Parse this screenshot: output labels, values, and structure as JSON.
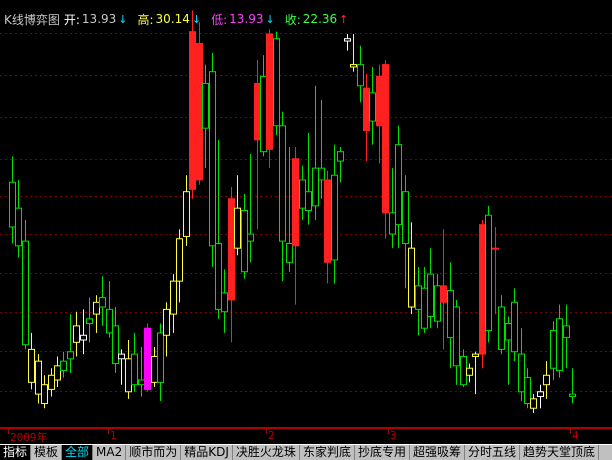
{
  "header": {
    "title": "K线博弈图",
    "open_label": "开:",
    "open_value": "13.93",
    "open_arrow": "↓",
    "high_label": "高:",
    "high_value": "30.14",
    "high_arrow": "↓",
    "low_label": "低:",
    "low_value": "13.93",
    "low_arrow": "↓",
    "close_label": "收:",
    "close_value": "22.36",
    "close_arrow": "↑"
  },
  "timeaxis": {
    "labels": [
      "2009年",
      "1",
      "2",
      "3",
      "4"
    ]
  },
  "tabs": [
    "指标",
    "模板",
    "全部",
    "MA2",
    "顺市而为",
    "精品KDJ",
    "决胜火龙珠",
    "东家判底",
    "抄底专用",
    "超强吸筹",
    "分时五线",
    "趋势天堂顶底"
  ],
  "colors": {
    "up": "#ff2020",
    "down": "#00e000",
    "yellow": "#ffff40",
    "magenta": "#ff00ff",
    "white": "#ffffff",
    "grid": "#800000"
  },
  "chart_data": {
    "type": "candlestick",
    "ohlc_summary": {
      "open": 13.93,
      "high": 30.14,
      "low": 13.93,
      "close": 22.36
    },
    "candles": [
      {
        "o": 24.0,
        "h": 25.1,
        "l": 21.4,
        "c": 22.1,
        "color": "green"
      },
      {
        "o": 22.9,
        "h": 24.1,
        "l": 20.8,
        "c": 21.3,
        "color": "green"
      },
      {
        "o": 21.5,
        "h": 22.4,
        "l": 16.9,
        "c": 17.1,
        "color": "green"
      },
      {
        "o": 16.9,
        "h": 17.6,
        "l": 15.2,
        "c": 15.5,
        "color": "yellow"
      },
      {
        "o": 16.4,
        "h": 16.7,
        "l": 14.6,
        "c": 15.0,
        "color": "yellow"
      },
      {
        "o": 15.4,
        "h": 15.8,
        "l": 14.4,
        "c": 14.6,
        "color": "yellow"
      },
      {
        "o": 15.8,
        "h": 16.1,
        "l": 14.9,
        "c": 15.2,
        "color": "yellow"
      },
      {
        "o": 16.2,
        "h": 16.6,
        "l": 15.3,
        "c": 15.6,
        "color": "yellow"
      },
      {
        "o": 16.0,
        "h": 16.8,
        "l": 15.7,
        "c": 16.4,
        "color": "green"
      },
      {
        "o": 16.5,
        "h": 18.4,
        "l": 15.9,
        "c": 16.8,
        "color": "green"
      },
      {
        "o": 17.2,
        "h": 18.5,
        "l": 16.6,
        "c": 17.9,
        "color": "yellow"
      },
      {
        "o": 17.3,
        "h": 18.6,
        "l": 16.7,
        "c": 17.5,
        "color": "white"
      },
      {
        "o": 18.2,
        "h": 19.1,
        "l": 17.2,
        "c": 18.0,
        "color": "green"
      },
      {
        "o": 18.4,
        "h": 19.2,
        "l": 17.6,
        "c": 18.9,
        "color": "yellow"
      },
      {
        "o": 19.1,
        "h": 20.0,
        "l": 17.9,
        "c": 18.7,
        "color": "green"
      },
      {
        "o": 18.6,
        "h": 19.8,
        "l": 17.4,
        "c": 17.6,
        "color": "green"
      },
      {
        "o": 17.9,
        "h": 18.7,
        "l": 15.9,
        "c": 16.3,
        "color": "green"
      },
      {
        "o": 16.7,
        "h": 16.9,
        "l": 15.4,
        "c": 16.5,
        "color": "white"
      },
      {
        "o": 16.5,
        "h": 17.3,
        "l": 14.8,
        "c": 15.1,
        "color": "yellow"
      },
      {
        "o": 16.7,
        "h": 17.6,
        "l": 15.1,
        "c": 15.4,
        "color": "green"
      },
      {
        "o": 15.4,
        "h": 17.0,
        "l": 14.9,
        "c": 15.6,
        "color": "green"
      },
      {
        "o": 15.2,
        "h": 18.0,
        "l": 15.1,
        "c": 17.8,
        "color": "magenta"
      },
      {
        "o": 16.6,
        "h": 17.0,
        "l": 15.3,
        "c": 15.5,
        "color": "yellow"
      },
      {
        "o": 15.5,
        "h": 18.0,
        "l": 14.7,
        "c": 17.6,
        "color": "green"
      },
      {
        "o": 17.5,
        "h": 18.9,
        "l": 16.6,
        "c": 18.6,
        "color": "yellow"
      },
      {
        "o": 18.4,
        "h": 20.1,
        "l": 17.6,
        "c": 19.8,
        "color": "yellow"
      },
      {
        "o": 19.8,
        "h": 22.0,
        "l": 18.9,
        "c": 21.6,
        "color": "yellow"
      },
      {
        "o": 21.7,
        "h": 24.3,
        "l": 21.3,
        "c": 23.6,
        "color": "yellow"
      },
      {
        "o": 23.7,
        "h": 31.3,
        "l": 23.3,
        "c": 30.4,
        "color": "red"
      },
      {
        "o": 29.9,
        "h": 30.8,
        "l": 23.9,
        "c": 24.1,
        "color": "red"
      },
      {
        "o": 26.3,
        "h": 29.0,
        "l": 24.6,
        "c": 28.2,
        "color": "green"
      },
      {
        "o": 28.7,
        "h": 29.5,
        "l": 20.4,
        "c": 21.3,
        "color": "green"
      },
      {
        "o": 21.4,
        "h": 25.8,
        "l": 18.2,
        "c": 18.6,
        "color": "green"
      },
      {
        "o": 18.5,
        "h": 20.3,
        "l": 17.6,
        "c": 19.3,
        "color": "green"
      },
      {
        "o": 19.0,
        "h": 23.8,
        "l": 17.2,
        "c": 23.3,
        "color": "red"
      },
      {
        "o": 22.9,
        "h": 24.3,
        "l": 20.9,
        "c": 21.2,
        "color": "yellow"
      },
      {
        "o": 22.8,
        "h": 23.5,
        "l": 19.9,
        "c": 20.2,
        "color": "green"
      },
      {
        "o": 21.8,
        "h": 25.2,
        "l": 20.6,
        "c": 21.5,
        "color": "green"
      },
      {
        "o": 25.8,
        "h": 29.2,
        "l": 22.0,
        "c": 28.2,
        "color": "red"
      },
      {
        "o": 28.5,
        "h": 29.4,
        "l": 25.1,
        "c": 25.3,
        "color": "green"
      },
      {
        "o": 25.4,
        "h": 30.5,
        "l": 24.6,
        "c": 30.3,
        "color": "red"
      },
      {
        "o": 30.1,
        "h": 30.4,
        "l": 26.0,
        "c": 26.4,
        "color": "green"
      },
      {
        "o": 26.4,
        "h": 27.0,
        "l": 19.8,
        "c": 21.5,
        "color": "green"
      },
      {
        "o": 21.4,
        "h": 25.5,
        "l": 20.2,
        "c": 20.6,
        "color": "green"
      },
      {
        "o": 21.3,
        "h": 25.5,
        "l": 18.8,
        "c": 25.0,
        "color": "red"
      },
      {
        "o": 24.1,
        "h": 24.7,
        "l": 22.4,
        "c": 22.9,
        "color": "green"
      },
      {
        "o": 23.6,
        "h": 26.1,
        "l": 22.2,
        "c": 22.8,
        "color": "green"
      },
      {
        "o": 23.0,
        "h": 28.1,
        "l": 22.4,
        "c": 24.6,
        "color": "green"
      },
      {
        "o": 24.6,
        "h": 27.5,
        "l": 23.3,
        "c": 24.1,
        "color": "green"
      },
      {
        "o": 24.1,
        "h": 24.5,
        "l": 19.7,
        "c": 20.6,
        "color": "red"
      },
      {
        "o": 20.7,
        "h": 25.6,
        "l": 19.7,
        "c": 24.3,
        "color": "green"
      },
      {
        "o": 24.9,
        "h": 25.5,
        "l": 24.0,
        "c": 25.3,
        "color": "green"
      },
      {
        "o": 30.1,
        "h": 30.3,
        "l": 29.6,
        "c": 30.0,
        "color": "white"
      },
      {
        "o": 29.0,
        "h": 30.3,
        "l": 28.7,
        "c": 28.9,
        "color": "yellow"
      },
      {
        "o": 29.0,
        "h": 29.8,
        "l": 27.4,
        "c": 28.1,
        "color": "green"
      },
      {
        "o": 26.2,
        "h": 28.6,
        "l": 24.9,
        "c": 28.0,
        "color": "red"
      },
      {
        "o": 27.8,
        "h": 28.9,
        "l": 25.6,
        "c": 26.6,
        "color": "green"
      },
      {
        "o": 26.4,
        "h": 29.0,
        "l": 24.8,
        "c": 28.5,
        "color": "red"
      },
      {
        "o": 29.0,
        "h": 29.2,
        "l": 21.6,
        "c": 22.7,
        "color": "red"
      },
      {
        "o": 22.7,
        "h": 24.6,
        "l": 21.2,
        "c": 21.8,
        "color": "green"
      },
      {
        "o": 22.2,
        "h": 26.4,
        "l": 21.2,
        "c": 25.6,
        "color": "green"
      },
      {
        "o": 23.6,
        "h": 24.3,
        "l": 19.5,
        "c": 21.4,
        "color": "green"
      },
      {
        "o": 21.2,
        "h": 22.3,
        "l": 18.4,
        "c": 18.7,
        "color": "yellow"
      },
      {
        "o": 18.6,
        "h": 20.4,
        "l": 17.5,
        "c": 19.6,
        "color": "green"
      },
      {
        "o": 19.5,
        "h": 20.4,
        "l": 17.6,
        "c": 17.8,
        "color": "green"
      },
      {
        "o": 18.3,
        "h": 21.2,
        "l": 17.8,
        "c": 20.1,
        "color": "green"
      },
      {
        "o": 19.6,
        "h": 20.1,
        "l": 17.8,
        "c": 18.1,
        "color": "green"
      },
      {
        "o": 19.6,
        "h": 22.0,
        "l": 16.9,
        "c": 18.9,
        "color": "red"
      },
      {
        "o": 19.4,
        "h": 20.6,
        "l": 16.1,
        "c": 17.4,
        "color": "green"
      },
      {
        "o": 18.7,
        "h": 19.0,
        "l": 15.4,
        "c": 16.2,
        "color": "green"
      },
      {
        "o": 16.6,
        "h": 16.9,
        "l": 15.3,
        "c": 15.4,
        "color": "green"
      },
      {
        "o": 16.1,
        "h": 16.3,
        "l": 15.5,
        "c": 15.8,
        "color": "yellow"
      },
      {
        "o": 16.6,
        "h": 16.8,
        "l": 15.0,
        "c": 16.7,
        "color": "yellow"
      },
      {
        "o": 16.7,
        "h": 22.4,
        "l": 16.1,
        "c": 22.2,
        "color": "red"
      },
      {
        "o": 22.6,
        "h": 23.0,
        "l": 17.2,
        "c": 17.7,
        "color": "green"
      },
      {
        "o": 21.2,
        "h": 22.1,
        "l": 18.4,
        "c": 21.2,
        "color": "red"
      },
      {
        "o": 18.7,
        "h": 19.2,
        "l": 16.7,
        "c": 16.9,
        "color": "green"
      },
      {
        "o": 17.3,
        "h": 18.3,
        "l": 15.4,
        "c": 18.0,
        "color": "green"
      },
      {
        "o": 18.9,
        "h": 19.5,
        "l": 16.4,
        "c": 16.8,
        "color": "green"
      },
      {
        "o": 16.7,
        "h": 17.8,
        "l": 14.7,
        "c": 15.1,
        "color": "green"
      },
      {
        "o": 15.7,
        "h": 16.1,
        "l": 14.4,
        "c": 14.6,
        "color": "green"
      },
      {
        "o": 14.8,
        "h": 15.0,
        "l": 14.2,
        "c": 14.4,
        "color": "yellow"
      },
      {
        "o": 14.9,
        "h": 15.4,
        "l": 14.4,
        "c": 15.1,
        "color": "white"
      },
      {
        "o": 15.4,
        "h": 16.4,
        "l": 14.8,
        "c": 15.8,
        "color": "yellow"
      },
      {
        "o": 16.1,
        "h": 18.1,
        "l": 15.6,
        "c": 17.7,
        "color": "green"
      },
      {
        "o": 18.2,
        "h": 18.8,
        "l": 15.7,
        "c": 16.0,
        "color": "green"
      },
      {
        "o": 17.9,
        "h": 18.8,
        "l": 16.1,
        "c": 17.4,
        "color": "green"
      },
      {
        "o": 15.0,
        "h": 16.1,
        "l": 14.6,
        "c": 14.9,
        "color": "green"
      }
    ]
  }
}
